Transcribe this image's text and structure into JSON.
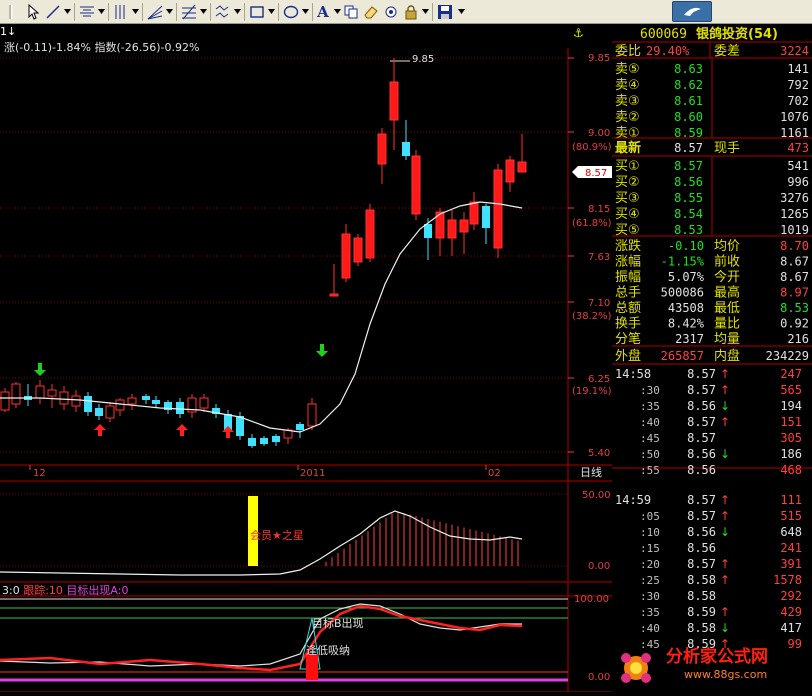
{
  "toolbar": {
    "items": [
      "cursor-tool",
      "line-tool",
      "parallel-tool",
      "vertical-lines-tool",
      "fan-tool",
      "grid-tool",
      "wave-tool",
      "rectangle-tool",
      "ellipse-tool",
      "text-tool",
      "copy-tool",
      "eraser-tool",
      "settings-tool",
      "lock-tool",
      "save-tool"
    ],
    "text_tool_label": "A"
  },
  "main_chart": {
    "header_arrows": "1↓",
    "header_text": "涨(-0.11)-1.84% 指数(-26.56)-0.92%",
    "high_label": "9.85",
    "price_axis": [
      "9.85",
      "9.00",
      "8.15",
      "7.63",
      "7.10",
      "6.25",
      "5.40"
    ],
    "pct_axis": [
      "(80.9%)",
      "(61.8%)",
      "(38.2%)",
      "(19.1%)"
    ],
    "current_price_tag": "8.57",
    "date_labels": [
      "12",
      "2011",
      "02"
    ],
    "period_label": "日线"
  },
  "indicator1": {
    "axis": [
      "50.00",
      "0.00"
    ],
    "highlight_label": "会员★之星"
  },
  "indicator2": {
    "header_prefix": "3:0",
    "header_track": "跟踪:10",
    "header_target": "目标出现A:0",
    "axis": [
      "100.00",
      "0.00"
    ],
    "label_target": "目标B出现",
    "label_low": "逢低吸纳"
  },
  "quote": {
    "code": "600069",
    "name": "银鸽投资(54)",
    "ratio_label": "委比",
    "ratio_value": "29.40%",
    "diff_label": "委差",
    "diff_value": "3224",
    "sell": [
      {
        "label": "卖⑤",
        "price": "8.63",
        "vol": "141"
      },
      {
        "label": "卖④",
        "price": "8.62",
        "vol": "792"
      },
      {
        "label": "卖③",
        "price": "8.61",
        "vol": "702"
      },
      {
        "label": "卖②",
        "price": "8.60",
        "vol": "1076"
      },
      {
        "label": "卖①",
        "price": "8.59",
        "vol": "1161"
      }
    ],
    "latest_label": "最新",
    "latest_price": "8.57",
    "hand_label": "现手",
    "hand_value": "473",
    "buy": [
      {
        "label": "买①",
        "price": "8.57",
        "vol": "541"
      },
      {
        "label": "买②",
        "price": "8.56",
        "vol": "996"
      },
      {
        "label": "买③",
        "price": "8.55",
        "vol": "3276"
      },
      {
        "label": "买④",
        "price": "8.54",
        "vol": "1265"
      },
      {
        "label": "买⑤",
        "price": "8.53",
        "vol": "1019"
      }
    ],
    "stats": [
      {
        "l1": "涨跌",
        "v1": "-0.10",
        "l2": "均价",
        "v2": "8.70"
      },
      {
        "l1": "涨幅",
        "v1": "-1.15%",
        "l2": "前收",
        "v2": "8.67"
      },
      {
        "l1": "振幅",
        "v1": "5.07%",
        "l2": "今开",
        "v2": "8.67"
      },
      {
        "l1": "总手",
        "v1": "500086",
        "l2": "最高",
        "v2": "8.97"
      },
      {
        "l1": "总额",
        "v1": "43508",
        "l2": "最低",
        "v2": "8.53"
      },
      {
        "l1": "换手",
        "v1": "8.42%",
        "l2": "量比",
        "v2": "0.92"
      },
      {
        "l1": "分笔",
        "v1": "2317",
        "l2": "均量",
        "v2": "216"
      }
    ],
    "outer_label": "外盘",
    "outer_value": "265857",
    "inner_label": "内盘",
    "inner_value": "234229",
    "ticks": [
      {
        "time": "14:58",
        "price": "8.57",
        "dir": "up",
        "vol": "247"
      },
      {
        "time": ":30",
        "price": "8.57",
        "dir": "up",
        "vol": "565"
      },
      {
        "time": ":35",
        "price": "8.56",
        "dir": "down",
        "vol": "194"
      },
      {
        "time": ":40",
        "price": "8.57",
        "dir": "up",
        "vol": "151"
      },
      {
        "time": ":45",
        "price": "8.57",
        "dir": "",
        "vol": "305"
      },
      {
        "time": ":50",
        "price": "8.56",
        "dir": "down",
        "vol": "186"
      },
      {
        "time": ":55",
        "price": "8.56",
        "dir": "",
        "vol": "468"
      },
      {
        "time": "14:59",
        "price": "8.57",
        "dir": "up",
        "vol": "111"
      },
      {
        "time": ":05",
        "price": "8.57",
        "dir": "up",
        "vol": "515"
      },
      {
        "time": ":10",
        "price": "8.56",
        "dir": "down",
        "vol": "648"
      },
      {
        "time": ":15",
        "price": "8.56",
        "dir": "",
        "vol": "241"
      },
      {
        "time": ":20",
        "price": "8.57",
        "dir": "up",
        "vol": "391"
      },
      {
        "time": ":25",
        "price": "8.58",
        "dir": "up",
        "vol": "1578"
      },
      {
        "time": ":30",
        "price": "8.58",
        "dir": "",
        "vol": "292"
      },
      {
        "time": ":35",
        "price": "8.59",
        "dir": "up",
        "vol": "429"
      },
      {
        "time": ":40",
        "price": "8.58",
        "dir": "down",
        "vol": "417"
      },
      {
        "time": ":45",
        "price": "8.59",
        "dir": "up",
        "vol": "99"
      }
    ]
  },
  "watermark": {
    "brand": "分析家公式网",
    "url": "www.88gs.com"
  }
}
